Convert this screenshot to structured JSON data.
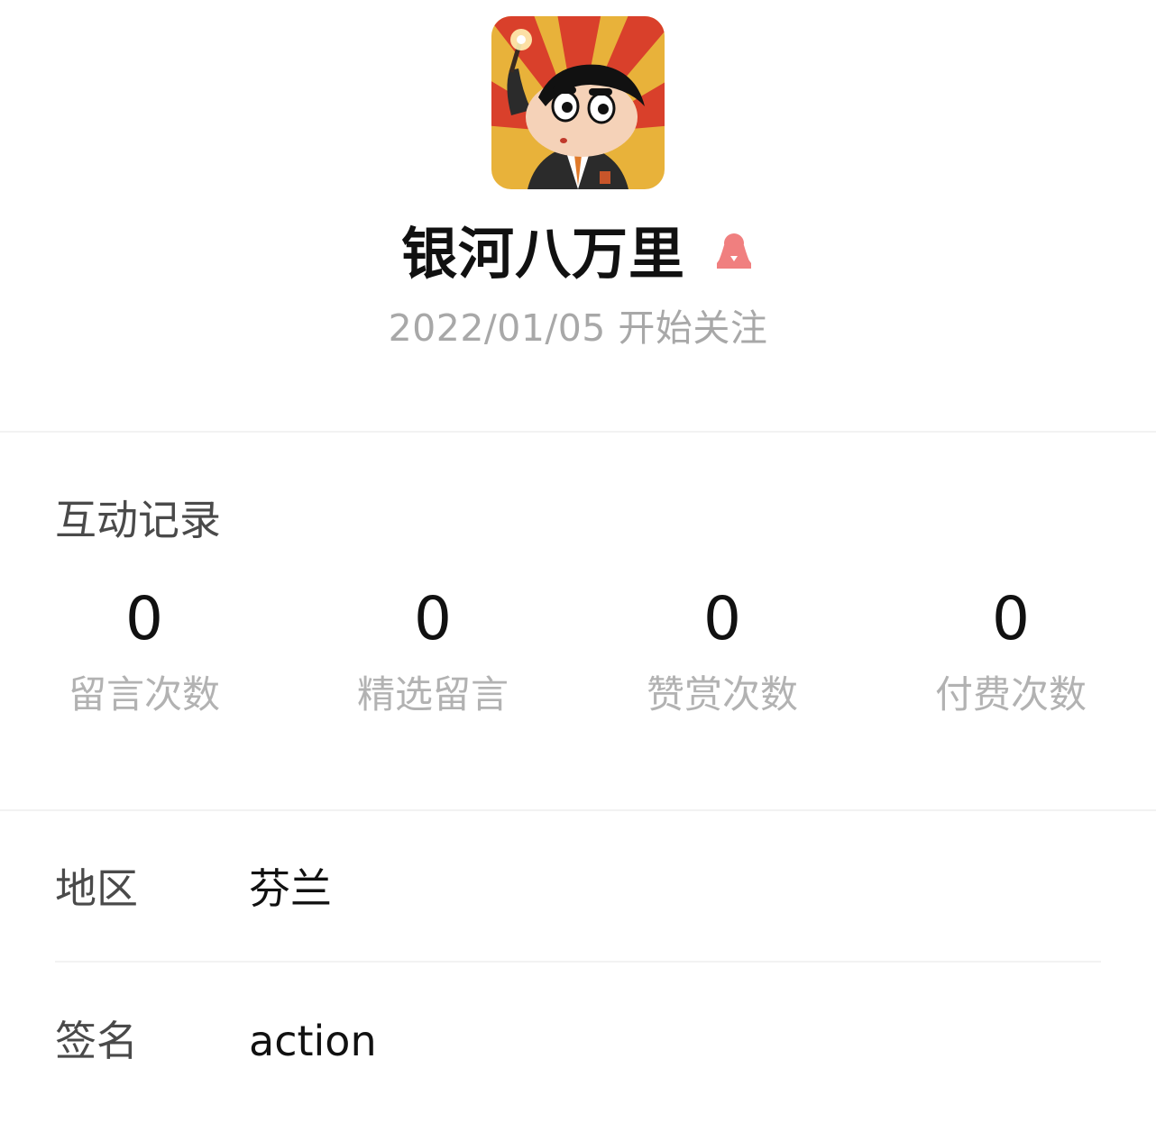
{
  "profile": {
    "name": "银河八万里",
    "follow_date": "2022/01/05 开始关注",
    "avatar_icon": "cartoon-boy-avatar",
    "gender_icon": "female-user-icon",
    "gender_color": "#f07f7f"
  },
  "interactions": {
    "title": "互动记录",
    "stats": [
      {
        "value": "0",
        "label": "留言次数"
      },
      {
        "value": "0",
        "label": "精选留言"
      },
      {
        "value": "0",
        "label": "赞赏次数"
      },
      {
        "value": "0",
        "label": "付费次数"
      }
    ]
  },
  "info": {
    "region_label": "地区",
    "region_value": "芬兰",
    "signature_label": "签名",
    "signature_value": "action"
  }
}
